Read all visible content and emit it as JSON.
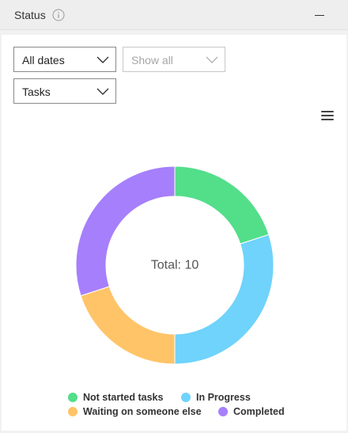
{
  "header": {
    "title": "Status",
    "info_icon": "info-icon",
    "minimize_icon": "minimize-icon"
  },
  "filters": {
    "date": {
      "value": "All dates",
      "icon": "chevron-down-icon"
    },
    "show": {
      "value": "Show all",
      "icon": "chevron-down-icon",
      "disabled": true
    },
    "type": {
      "value": "Tasks",
      "icon": "chevron-down-icon"
    }
  },
  "chart_menu_icon": "hamburger-menu-icon",
  "chart_data": {
    "type": "pie",
    "center_label": "Total: 10",
    "categories": [
      "Not started tasks",
      "In Progress",
      "Waiting on someone else",
      "Completed"
    ],
    "values": [
      2,
      3,
      2,
      3
    ],
    "colors": [
      "#53de8a",
      "#6fd3fb",
      "#ffc468",
      "#a67ffc"
    ],
    "legend_position": "bottom"
  }
}
